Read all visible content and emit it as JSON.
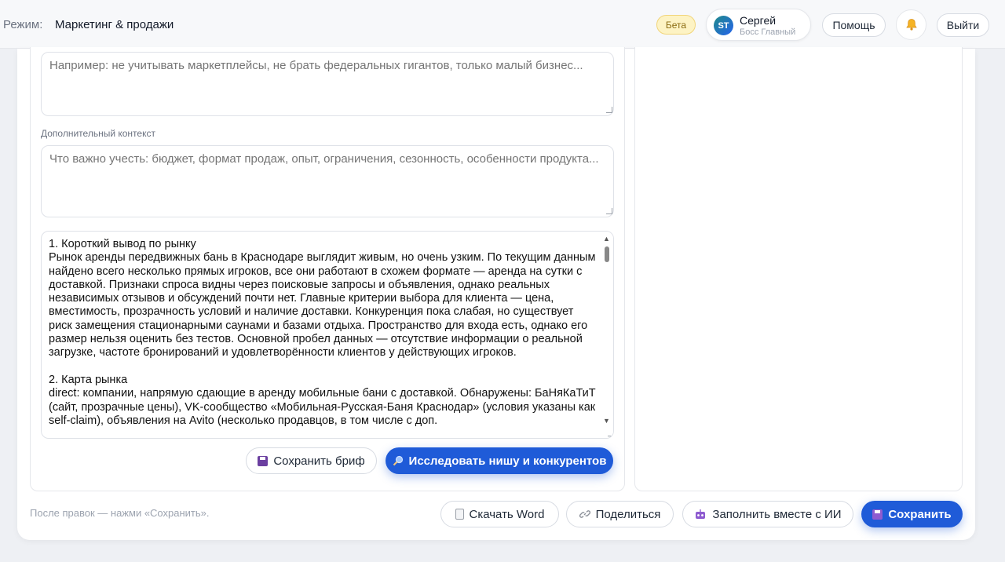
{
  "header": {
    "mode_label": "Режим:",
    "mode_value": "Маркетинг & продажи",
    "beta_badge": "Бета",
    "user": {
      "initials": "ST",
      "name": "Сергей",
      "role": "Босс Главный"
    },
    "help_label": "Помощь",
    "logout_label": "Выйти",
    "bell_icon": "bell-icon"
  },
  "form": {
    "exclusions_placeholder": "Например: не учитывать маркетплейсы, не брать федеральных гигантов, только малый бизнес...",
    "context_label": "Дополнительный контекст",
    "context_placeholder": "Что важно учесть: бюджет, формат продаж, опыт, ограничения, сезонность, особенности продукта...",
    "result_text": "1. Короткий вывод по рынку\nРынок аренды передвижных бань в Краснодаре выглядит живым, но очень узким. По текущим данным найдено всего несколько прямых игроков, все они работают в схожем формате — аренда на сутки с доставкой. Признаки спроса видны через поисковые запросы и объявления, однако реальных независимых отзывов и обсуждений почти нет. Главные критерии выбора для клиента — цена, вместимость, прозрачность условий и наличие доставки. Конкуренция пока слабая, но существует риск замещения стационарными саунами и базами отдыха. Пространство для входа есть, однако его размер нельзя оценить без тестов. Основной пробел данных — отсутствие информации о реальной загрузке, частоте бронирований и удовлетворённости клиентов у действующих игроков.\n\n2. Карта рынка\ndirect: компании, напрямую сдающие в аренду мобильные бани с доставкой. Обнаружены: БаНяКаТиТ (сайт, прозрачные цены), VK-сообщество «Мобильная-Русская-Баня Краснодар» (условия указаны как self-claim), объявления на Avito (несколько продавцов, в том числе с доп.",
    "save_brief_label": "Сохранить бриф",
    "research_label": "Исследовать нишу и конкурентов"
  },
  "footer": {
    "hint": "После правок — нажми «Сохранить».",
    "download_word_label": "Скачать Word",
    "share_label": "Поделиться",
    "fill_ai_label": "Заполнить вместе с ИИ",
    "save_label": "Сохранить"
  },
  "colors": {
    "primary": "#1f5bd8",
    "beta_bg": "#fdf3c4",
    "bell": "#f2a51a"
  }
}
